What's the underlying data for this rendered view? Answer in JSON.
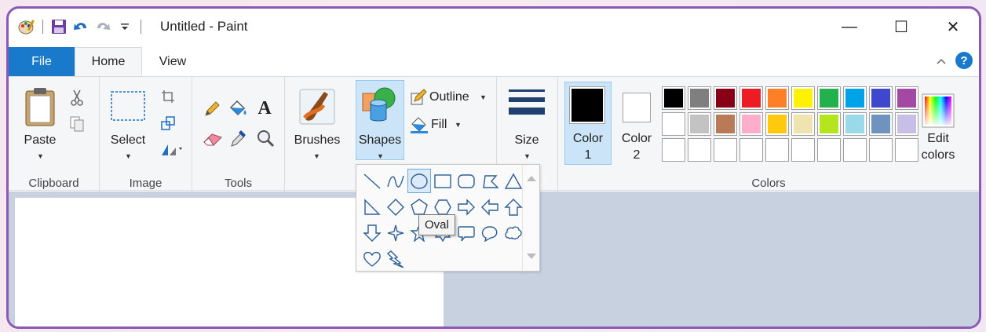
{
  "window": {
    "title": "Untitled - Paint",
    "controls": {
      "minimize": "—",
      "maximize": "☐",
      "close": "✕"
    }
  },
  "tabs": [
    {
      "label": "File"
    },
    {
      "label": "Home"
    },
    {
      "label": "View"
    }
  ],
  "ribbon": {
    "clipboard": {
      "paste": "Paste",
      "group": "Clipboard"
    },
    "image": {
      "select": "Select",
      "group": "Image"
    },
    "tools": {
      "group": "Tools"
    },
    "brushes": {
      "label": "Brushes"
    },
    "shapes": {
      "label": "Shapes",
      "outline": "Outline",
      "fill": "Fill"
    },
    "size": {
      "label": "Size"
    },
    "colors": {
      "color1_a": "Color",
      "color1_b": "1",
      "color2_a": "Color",
      "color2_b": "2",
      "edit_a": "Edit",
      "edit_b": "colors",
      "group": "Colors",
      "color1_value": "#000000",
      "color2_value": "#ffffff",
      "row1": [
        "#000000",
        "#7f7f7f",
        "#880015",
        "#ed1c24",
        "#ff7f27",
        "#fff200",
        "#22b14c",
        "#00a2e8",
        "#3f48cc",
        "#a349a4"
      ],
      "row2": [
        "#ffffff",
        "#c3c3c3",
        "#b97a57",
        "#ffaec9",
        "#ffc90e",
        "#efe4b0",
        "#b5e61d",
        "#99d9ea",
        "#7092be",
        "#c8bfe7"
      ],
      "row3_empty_count": 10
    }
  },
  "shapes_gallery": {
    "tooltip": "Oval",
    "highlighted": "oval",
    "items": [
      "line",
      "curve",
      "oval",
      "rectangle",
      "rounded-rectangle",
      "polygon",
      "triangle",
      "right-triangle",
      "diamond",
      "pentagon",
      "hexagon",
      "right-arrow",
      "left-arrow",
      "up-arrow",
      "down-arrow",
      "four-point-star",
      "five-point-star",
      "six-point-star",
      "rounded-rectangle-callout",
      "oval-callout",
      "cloud-callout",
      "heart",
      "lightning"
    ]
  }
}
